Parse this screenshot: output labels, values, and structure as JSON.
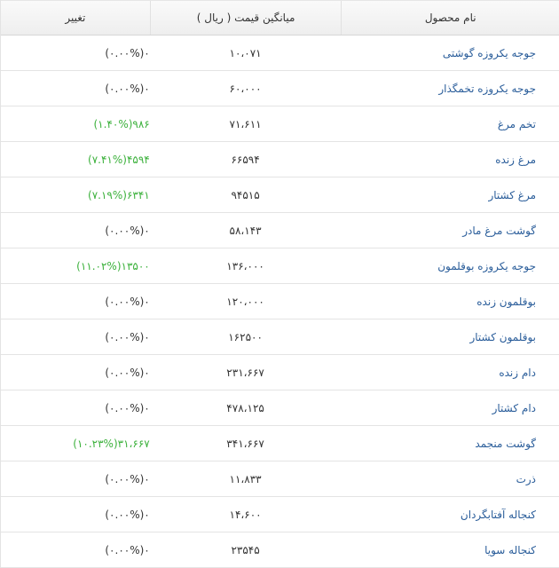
{
  "header": {
    "name": "نام محصول",
    "price": "میانگین قیمت ( ریال )",
    "change": "تغییر"
  },
  "colors": {
    "positive": "#3cb13c",
    "neutral": "#333333",
    "name": "#2a5d9a"
  },
  "rows": [
    {
      "name": "جوجه یکروزه گوشتی",
      "price": "۱۰،۰۷۱",
      "change": "(۰.۰۰%)۰",
      "up": false
    },
    {
      "name": "جوجه یکروزه تخمگذار",
      "price": "۶۰،۰۰۰",
      "change": "(۰.۰۰%)۰",
      "up": false
    },
    {
      "name": "تخم مرغ",
      "price": "۷۱،۶۱۱",
      "change": "(۱.۴۰%)۹۸۶",
      "up": true
    },
    {
      "name": "مرغ زنده",
      "price": "۶۶۵۹۴",
      "change": "(۷.۴۱%)۴۵۹۴",
      "up": true
    },
    {
      "name": "مرغ کشتار",
      "price": "۹۴۵۱۵",
      "change": "(۷.۱۹%)۶۳۴۱",
      "up": true
    },
    {
      "name": "گوشت مرغ مادر",
      "price": "۵۸،۱۴۳",
      "change": "(۰.۰۰%)۰",
      "up": false
    },
    {
      "name": "جوجه یکروزه بوقلمون",
      "price": "۱۳۶،۰۰۰",
      "change": "(۱۱.۰۲%)۱۳۵۰۰",
      "up": true
    },
    {
      "name": "بوقلمون زنده",
      "price": "۱۲۰،۰۰۰",
      "change": "(۰.۰۰%)۰",
      "up": false
    },
    {
      "name": "بوقلمون کشتار",
      "price": "۱۶۲۵۰۰",
      "change": "(۰.۰۰%)۰",
      "up": false
    },
    {
      "name": "دام زنده",
      "price": "۲۳۱،۶۶۷",
      "change": "(۰.۰۰%)۰",
      "up": false
    },
    {
      "name": "دام کشتار",
      "price": "۴۷۸،۱۲۵",
      "change": "(۰.۰۰%)۰",
      "up": false
    },
    {
      "name": "گوشت منجمد",
      "price": "۳۴۱،۶۶۷",
      "change": "(۱۰.۲۳%)۳۱،۶۶۷",
      "up": true
    },
    {
      "name": "ذرت",
      "price": "۱۱،۸۳۳",
      "change": "(۰.۰۰%)۰",
      "up": false
    },
    {
      "name": "کنجاله آفتابگردان",
      "price": "۱۴،۶۰۰",
      "change": "(۰.۰۰%)۰",
      "up": false
    },
    {
      "name": "کنجاله سویا",
      "price": "۲۳۵۴۵",
      "change": "(۰.۰۰%)۰",
      "up": false
    }
  ]
}
